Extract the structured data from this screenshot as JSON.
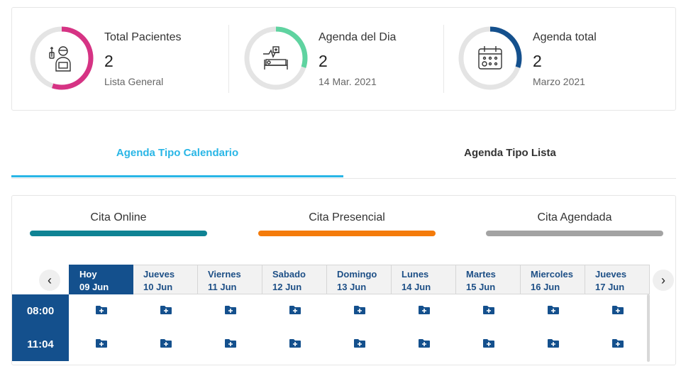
{
  "stats": [
    {
      "title": "Total Pacientes",
      "value": "2",
      "sub": "Lista General",
      "icon": "patient-icon",
      "ring_color": "#d63384",
      "ring_fraction": 0.55
    },
    {
      "title": "Agenda del Dia",
      "value": "2",
      "sub": "14 Mar. 2021",
      "icon": "hospital-bed-icon",
      "ring_color": "#5fd3a0",
      "ring_fraction": 0.3
    },
    {
      "title": "Agenda total",
      "value": "2",
      "sub": "Marzo 2021",
      "icon": "calendar-icon",
      "ring_color": "#14508d",
      "ring_fraction": 0.3
    }
  ],
  "tabs": {
    "calendar": "Agenda Tipo Calendario",
    "list": "Agenda Tipo Lista"
  },
  "legend": [
    {
      "label": "Cita Online",
      "color": "#0f8394"
    },
    {
      "label": "Cita Presencial",
      "color": "#f47b0a"
    },
    {
      "label": "Cita Agendada",
      "color": "#a3a3a3"
    }
  ],
  "nav": {
    "prev": "‹",
    "next": "›"
  },
  "days": [
    {
      "name": "Hoy",
      "date": "09 Jun"
    },
    {
      "name": "Jueves",
      "date": "10 Jun"
    },
    {
      "name": "Viernes",
      "date": "11 Jun"
    },
    {
      "name": "Sabado",
      "date": "12 Jun"
    },
    {
      "name": "Domingo",
      "date": "13 Jun"
    },
    {
      "name": "Lunes",
      "date": "14 Jun"
    },
    {
      "name": "Martes",
      "date": "15 Jun"
    },
    {
      "name": "Miercoles",
      "date": "16 Jun"
    },
    {
      "name": "Jueves",
      "date": "17 Jun"
    }
  ],
  "times": [
    "08:00",
    "11:04"
  ],
  "slot_icon": "add-folder-icon",
  "colors": {
    "primary": "#14508d",
    "accent": "#29b6e6"
  }
}
